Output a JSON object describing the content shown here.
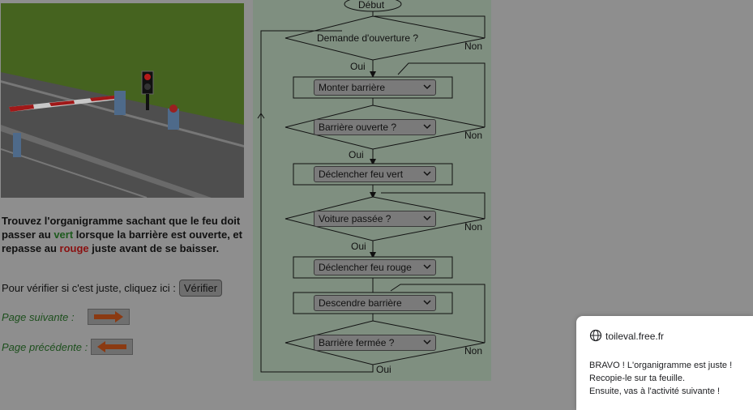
{
  "instructions": {
    "part1": "Trouvez l'organigramme sachant que le feu doit passer au ",
    "green_word": "vert",
    "part2": " lorsque la barrière est ouverte, et repasse au ",
    "red_word": "rouge",
    "part3": " juste avant de se baisser."
  },
  "verify": {
    "prompt": "Pour vérifier si c'est juste, cliquez ici :",
    "button_label": "Vérifier"
  },
  "navigation": {
    "next_label": "Page suivante :",
    "prev_label": "Page précédente :"
  },
  "flowchart": {
    "start_label": "Début",
    "question1": "Demande d'ouverture ?",
    "blocks": {
      "b1": "Monter barrière",
      "q2": "Barrière ouverte ?",
      "b2": "Déclencher feu vert",
      "q3": "Voiture passée ?",
      "b3": "Déclencher feu rouge",
      "b4": "Descendre barrière",
      "q4": "Barrière fermée ?"
    },
    "yes_label": "Oui",
    "no_label": "Non"
  },
  "popup": {
    "domain": "toileval.free.fr",
    "line1": "BRAVO ! L'organigramme est juste !",
    "line2": "Recopie-le sur ta feuille.",
    "line3": "Ensuite, vas à l'activité suivante !"
  },
  "colors": {
    "overlay_gray": "#8e8e8e",
    "flowchart_bg": "#7f8f80",
    "green_text": "#1d5a1d",
    "red_text": "#8a1010"
  }
}
